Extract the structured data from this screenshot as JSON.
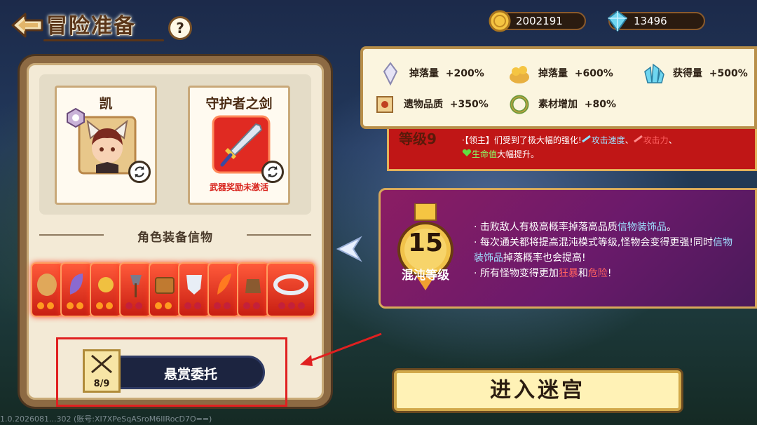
{
  "header": {
    "title": "冒险准备",
    "help": "?"
  },
  "currency": {
    "gold": "2002191",
    "gems": "13496"
  },
  "characters": [
    {
      "name": "凯",
      "icon": "fox-eared-boy-portrait"
    },
    {
      "name": "守护者之剑",
      "icon": "sword-icon",
      "warning": "武器奖励未激活"
    }
  ],
  "section_title": "角色装备信物",
  "relic_icons": [
    "sack-icon",
    "feather-icon",
    "axe-icon",
    "chest-icon",
    "shield-icon",
    "flame-feather-icon",
    "bag-icon",
    "ring-icon"
  ],
  "bounty": {
    "label": "悬赏委托",
    "count": "8/9"
  },
  "footer": "1.0.2026081...302 (账号:XI7XPeSqASroM6lIRocD7O==)",
  "bonuses": [
    {
      "icon": "crystal-icon",
      "label": "掉落量",
      "value": "+200%"
    },
    {
      "icon": "gold-pile-icon",
      "label": "掉落量",
      "value": "+600%"
    },
    {
      "icon": "gem-cluster-icon",
      "label": "获得量",
      "value": "+500%"
    },
    {
      "icon": "scroll-icon",
      "label": "遗物品质",
      "value": "+350%"
    },
    {
      "icon": "wreath-icon",
      "label": "素材增加",
      "value": "+80%"
    }
  ],
  "level9": {
    "title": "等级9",
    "text_parts": [
      "·【领主】们受到了极大幅的强化!",
      "攻击速度",
      "、",
      "攻击力",
      "、",
      "生命值",
      "大幅提升。"
    ]
  },
  "chaos": {
    "level": "15",
    "label": "混沌等级",
    "lines": [
      [
        "· 击败敌人有极高概率掉落高品质",
        "信物装饰品",
        "。"
      ],
      [
        "· 每次通关都将提高混沌模式等级,怪物会变得更强!同时",
        "信物装饰品",
        "掉落概率也会提高!"
      ],
      [
        "· 所有怪物变得更加",
        "狂暴",
        "和",
        "危险",
        "!"
      ]
    ]
  },
  "enter_button": "进入迷宫",
  "colors": {
    "accent_red": "#e02020",
    "panel_bg": "#f3ead6",
    "chaos_bg": "#7a1a66",
    "highlight_blue": "#9fe0ff"
  }
}
